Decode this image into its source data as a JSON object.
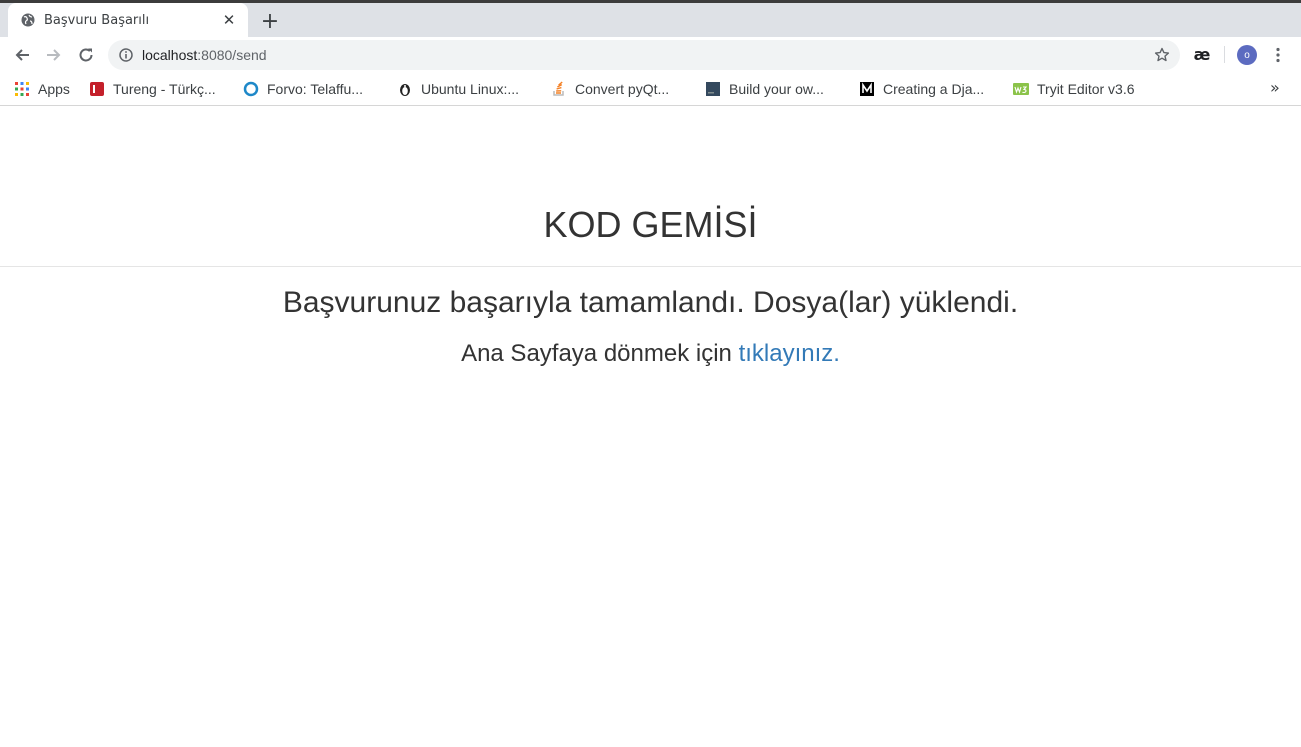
{
  "browser": {
    "tab": {
      "title": "Başvuru Başarılı",
      "close": "✕"
    },
    "new_tab": "+",
    "omnibox": {
      "host": "localhost",
      "path": ":8080/send"
    },
    "profile_initial": "o",
    "extension_label": "æ",
    "bookmarks": [
      {
        "label": "Apps",
        "icon": "apps-grid-icon"
      },
      {
        "label": "Tureng - Türkç...",
        "icon": "tureng-icon",
        "color": "#c4202b"
      },
      {
        "label": "Forvo: Telaffu...",
        "icon": "forvo-icon",
        "color": "#1e88c8"
      },
      {
        "label": "Ubuntu Linux:...",
        "icon": "penguin-icon",
        "color": "#222222"
      },
      {
        "label": "Convert pyQt...",
        "icon": "stackoverflow-icon",
        "color": "#f48024"
      },
      {
        "label": "Build your ow...",
        "icon": "build-site-icon",
        "color": "#34495e"
      },
      {
        "label": "Creating a Dja...",
        "icon": "medium-icon",
        "color": "#000000"
      },
      {
        "label": "Tryit Editor v3.6",
        "icon": "w3schools-icon",
        "color": "#8bc34a"
      }
    ],
    "bookmarks_more": "»"
  },
  "page": {
    "site_title": "KOD GEMİSİ",
    "success_message": "Başvurunuz başarıyla tamamlandı. Dosya(lar) yüklendi.",
    "return_text": "Ana Sayfaya dönmek için",
    "return_link": "tıklayınız."
  }
}
